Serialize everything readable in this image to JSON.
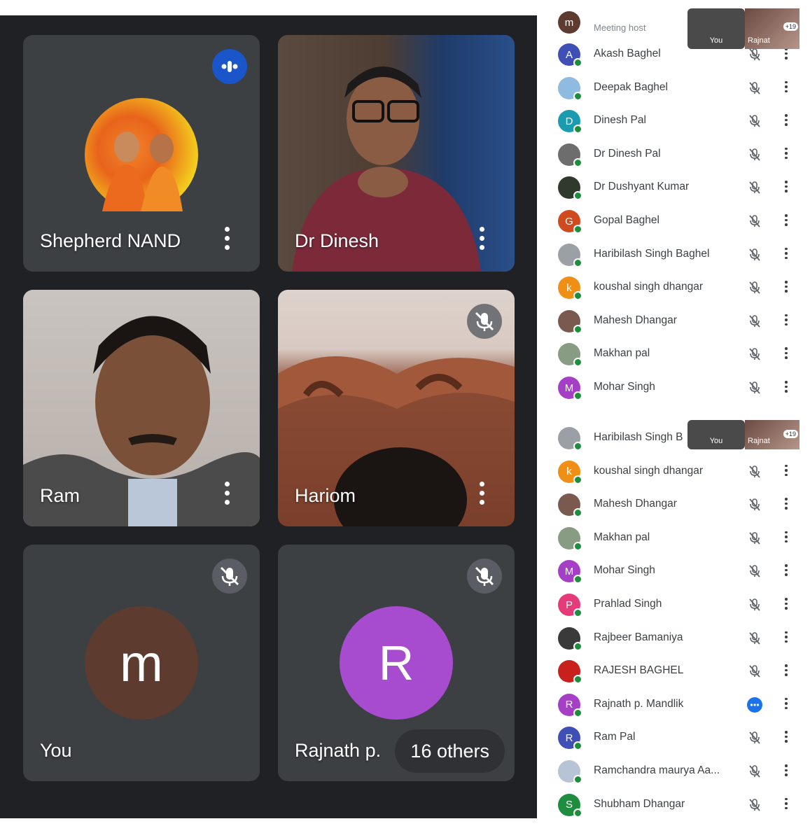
{
  "meeting_grid": {
    "tiles": [
      {
        "name": "Shepherd NAND",
        "state": "speaking"
      },
      {
        "name": "Dr Dinesh",
        "state": "video"
      },
      {
        "name": "Ram",
        "state": "video"
      },
      {
        "name": "Hariom",
        "state": "muted"
      },
      {
        "name": "You",
        "avatar_letter": "m",
        "avatar_color": "#5d3b2f",
        "state": "muted"
      },
      {
        "name": "Rajnath p.",
        "avatar_letter": "R",
        "avatar_color": "#a84ccf",
        "state": "muted"
      }
    ],
    "others_label": "16 others"
  },
  "people_panel": {
    "host_role": "Meeting host",
    "pip_self_label": "You",
    "pip_other_label": "Rajnat",
    "pip_count": "+19",
    "list1": [
      {
        "name": "Akash Baghel",
        "letter": "A",
        "color": "#3f4fb5"
      },
      {
        "name": "Deepak Baghel",
        "letter": "",
        "color": "#8fbbe0"
      },
      {
        "name": "Dinesh Pal",
        "letter": "D",
        "color": "#1a9bb0"
      },
      {
        "name": "Dr Dinesh Pal",
        "letter": "",
        "color": "#6d6d6d"
      },
      {
        "name": "Dr Dushyant Kumar",
        "letter": "",
        "color": "#2f3a2c"
      },
      {
        "name": "Gopal Baghel",
        "letter": "G",
        "color": "#cf4a1f"
      },
      {
        "name": "Haribilash Singh Baghel",
        "letter": "",
        "color": "#9aa0a6"
      },
      {
        "name": "koushal singh dhangar",
        "letter": "k",
        "color": "#ef8f15"
      },
      {
        "name": "Mahesh Dhangar",
        "letter": "",
        "color": "#7a5a4e"
      },
      {
        "name": "Makhan pal",
        "letter": "",
        "color": "#889c83"
      },
      {
        "name": "Mohar Singh",
        "letter": "M",
        "color": "#a43fc6"
      }
    ],
    "list2": [
      {
        "name": "Haribilash Singh B",
        "letter": "",
        "color": "#9aa0a6"
      },
      {
        "name": "koushal singh dhangar",
        "letter": "k",
        "color": "#ef8f15"
      },
      {
        "name": "Mahesh Dhangar",
        "letter": "",
        "color": "#7a5a4e"
      },
      {
        "name": "Makhan pal",
        "letter": "",
        "color": "#889c83"
      },
      {
        "name": "Mohar Singh",
        "letter": "M",
        "color": "#a43fc6"
      },
      {
        "name": "Prahlad Singh",
        "letter": "P",
        "color": "#e53b7b"
      },
      {
        "name": "Rajbeer Bamaniya",
        "letter": "",
        "color": "#3a3a3a"
      },
      {
        "name": "RAJESH BAGHEL",
        "letter": "",
        "color": "#c8201c"
      },
      {
        "name": "Rajnath p. Mandlik",
        "letter": "R",
        "color": "#a43fc6",
        "speaking": true
      },
      {
        "name": "Ram Pal",
        "letter": "R",
        "color": "#3f4fb5"
      },
      {
        "name": "Ramchandra maurya Aa...",
        "letter": "",
        "color": "#b7c4d6"
      },
      {
        "name": "Shubham Dhangar",
        "letter": "S",
        "color": "#1e8e3e"
      }
    ]
  }
}
